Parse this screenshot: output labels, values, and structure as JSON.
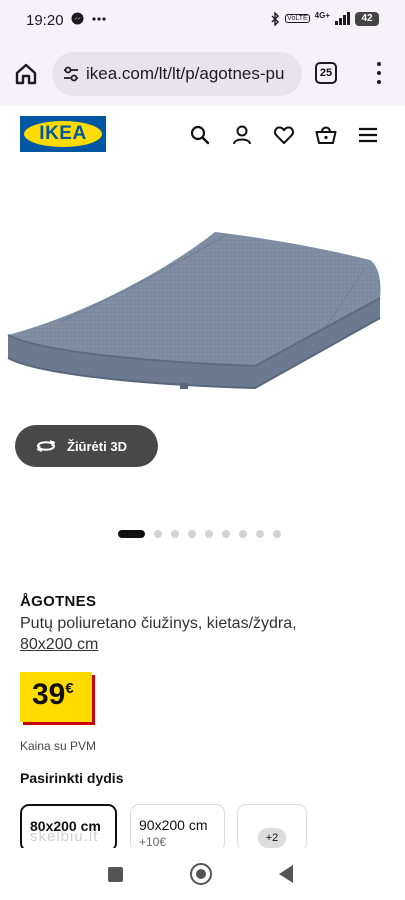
{
  "status_bar": {
    "time": "19:20",
    "network": "4G+",
    "volte": "VoLTE",
    "battery": "42"
  },
  "browser": {
    "url": "ikea.com/lt/lt/p/agotnes-pu",
    "tab_count": "25"
  },
  "header": {
    "logo_text": "IKEA",
    "icons": [
      "search-icon",
      "user-icon",
      "heart-icon",
      "basket-icon",
      "menu-icon"
    ]
  },
  "gallery": {
    "view3d_label": "Žiūrėti 3D",
    "image_count": 9,
    "active_index": 0
  },
  "product": {
    "name": "ÅGOTNES",
    "description": "Putų poliuretano čiužinys, kietas/žydra,",
    "size_link": "80x200 cm",
    "price": "39",
    "currency": "€",
    "vat_note": "Kaina su PVM",
    "choose_size_label": "Pasirinkti dydis",
    "sizes": [
      {
        "label": "80x200 cm",
        "sub": ""
      },
      {
        "label": "90x200 cm",
        "sub": "+10€"
      }
    ],
    "more_sizes": "+2"
  },
  "watermark": "skelbiu.lt",
  "colors": {
    "ikea_blue": "#0058a3",
    "ikea_yellow": "#ffdb00",
    "price_shadow": "#cc0008",
    "mattress": "#7f8da3"
  }
}
